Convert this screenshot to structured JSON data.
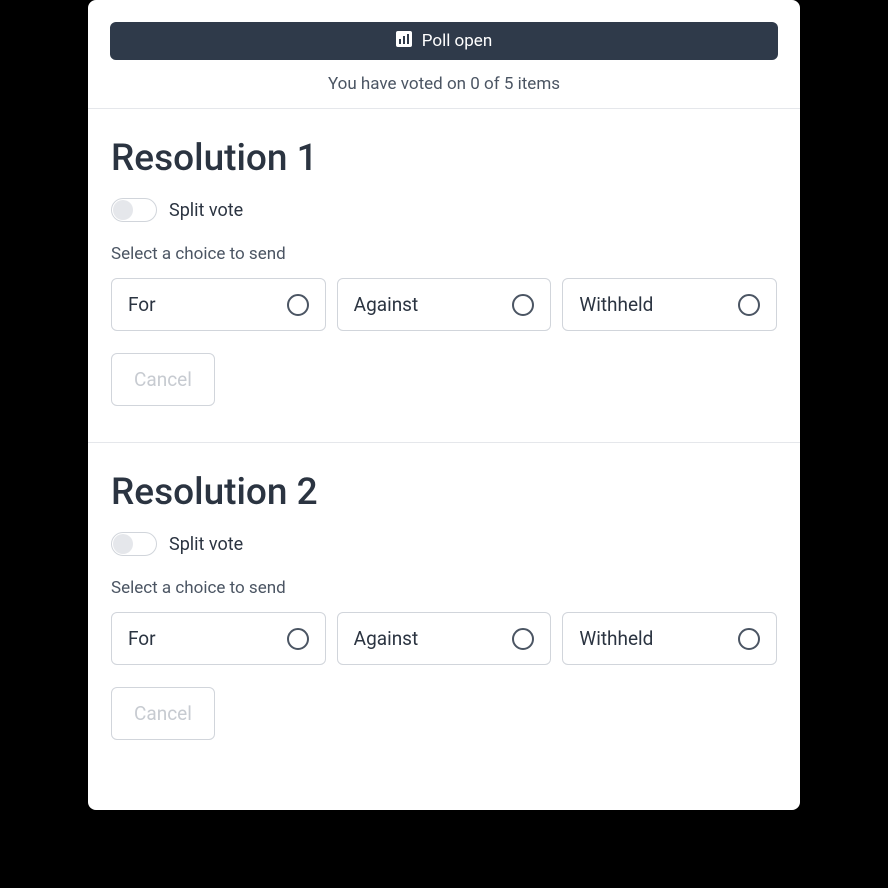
{
  "header": {
    "poll_status": "Poll open",
    "vote_status": "You have voted on 0 of 5 items"
  },
  "resolutions": [
    {
      "title": "Resolution 1",
      "split_label": "Split vote",
      "select_prompt": "Select a choice to send",
      "choices": [
        "For",
        "Against",
        "Withheld"
      ],
      "cancel_label": "Cancel"
    },
    {
      "title": "Resolution 2",
      "split_label": "Split vote",
      "select_prompt": "Select a choice to send",
      "choices": [
        "For",
        "Against",
        "Withheld"
      ],
      "cancel_label": "Cancel"
    }
  ]
}
